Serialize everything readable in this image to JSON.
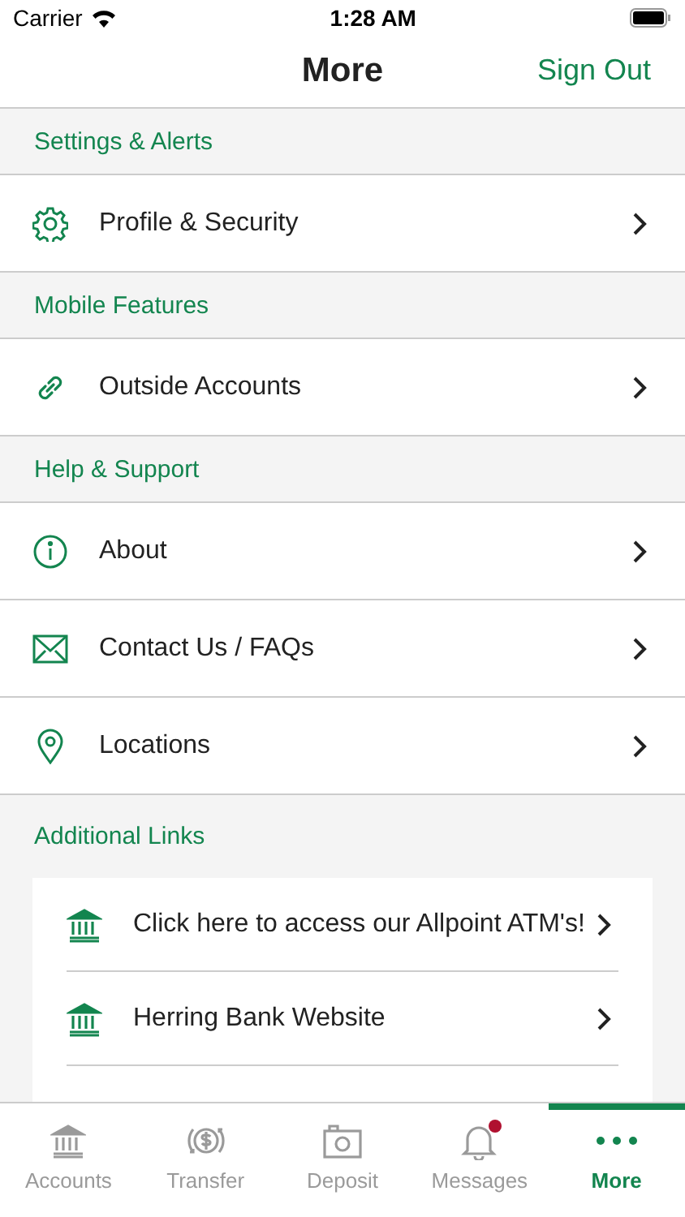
{
  "status_bar": {
    "carrier": "Carrier",
    "time": "1:28 AM"
  },
  "nav": {
    "title": "More",
    "action": "Sign Out"
  },
  "sections": [
    {
      "title": "Settings & Alerts",
      "items": [
        {
          "label": "Profile & Security"
        }
      ]
    },
    {
      "title": "Mobile Features",
      "items": [
        {
          "label": "Outside Accounts"
        }
      ]
    },
    {
      "title": "Help & Support",
      "items": [
        {
          "label": "About"
        },
        {
          "label": "Contact Us / FAQs"
        },
        {
          "label": "Locations"
        }
      ]
    }
  ],
  "additional_links": {
    "title": "Additional Links",
    "items": [
      {
        "label": "Click here to access our Allpoint ATM's!"
      },
      {
        "label": "Herring Bank Website"
      }
    ]
  },
  "tab_bar": [
    {
      "label": "Accounts",
      "selected": false,
      "badge": false
    },
    {
      "label": "Transfer",
      "selected": false,
      "badge": false
    },
    {
      "label": "Deposit",
      "selected": false,
      "badge": false
    },
    {
      "label": "Messages",
      "selected": false,
      "badge": true
    },
    {
      "label": "More",
      "selected": true,
      "badge": false
    }
  ]
}
